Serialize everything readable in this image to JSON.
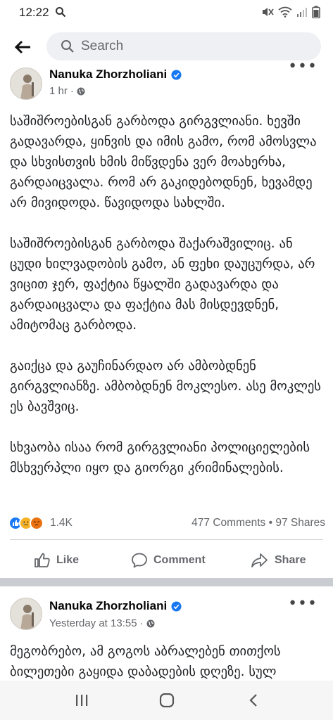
{
  "status_bar": {
    "time": "12:22"
  },
  "search": {
    "placeholder": "Search"
  },
  "post1": {
    "author": "Nanuka Zhorzholiani",
    "time": "1 hr",
    "paragraphs": [
      "საშიშროებისგან გარბოდა გირგვლიანი. ხევში გადავარდა, ყინვის და იმის გამო, რომ ამოსვლა და სხვისთვის ხმის მიწვდენა ვერ მოახერხა, გარდაიცვალა. რომ არ გაკიდებოდნენ, ხევამდე არ მივიდოდა. წავიდოდა სახლში.",
      "საშიშროებისგან გარბოდა შაქარაშვილიც. ან ცუდი ხილვადობის გამო, ან ფეხი დაუცურდა, არ ვიცით ჯერ, ფაქტია წყალში გადავარდა და გარდაიცვალა და ფაქტია მას მისდევდნენ, ამიტომაც გარბოდა.",
      "გაიქცა და გაუჩინარდაო არ ამბობდნენ გირგვლიანზე. ამბობდნენ მოკლესო. ასე მოკლეს ეს ბავშვიც.",
      "სხვაობა ისაა რომ გირგვლიანი პოლიციელების მსხვერპლი იყო და გიორგი კრიმინალების."
    ],
    "reaction_count": "1.4K",
    "comments": "477 Comments",
    "shares": "97 Shares",
    "like_label": "Like",
    "comment_label": "Comment",
    "share_label": "Share"
  },
  "post2": {
    "author": "Nanuka Zhorzholiani",
    "time": "Yesterday at 13:55",
    "text": "მეგობრებო, ამ გოგოს აბრალებენ თითქოს ბილეთები გაყიდა დაბადების დღეზე. სულ"
  },
  "colors": {
    "verified": "#1877f2",
    "like_blue": "#1877f2",
    "separator": "#c9ccd1"
  }
}
